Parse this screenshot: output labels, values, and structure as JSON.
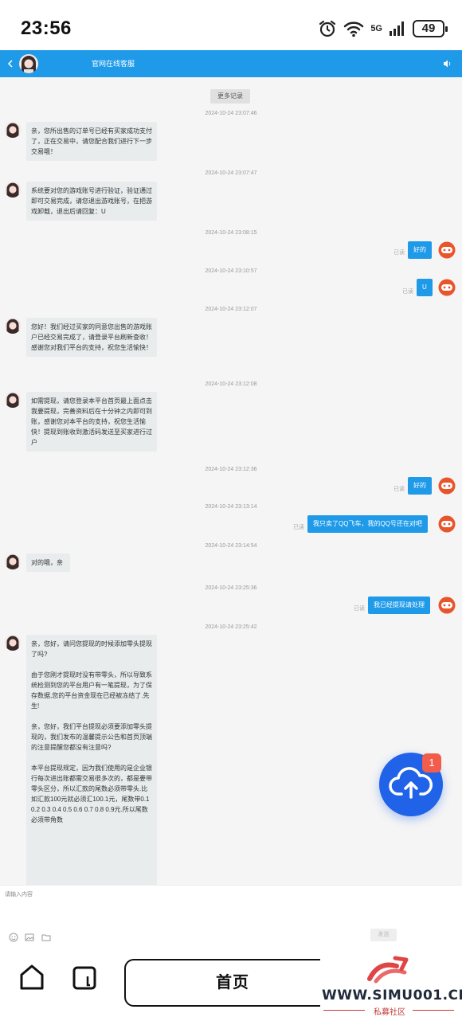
{
  "status_bar": {
    "time": "23:56",
    "network": "5G",
    "battery": "49",
    "icons": [
      "alarm-icon",
      "wifi-icon",
      "signal-icon",
      "battery-icon"
    ]
  },
  "header": {
    "title": "官网在线客服",
    "bg_color": "#1e9ae8",
    "icons": [
      "back-icon",
      "speaker-icon"
    ]
  },
  "chat": {
    "more_history": "更多记录",
    "read_label": "已读",
    "messages": [
      {
        "time": "2024-10-24 23:07:46",
        "side": "left",
        "paragraphs": [
          "亲，您所出售的订单号已经有买家成功支付了，正在交易中，请您配合我们进行下一步交易哦！"
        ]
      },
      {
        "time": "2024-10-24 23:07:47",
        "side": "left",
        "paragraphs": [
          "系统要对您的游戏账号进行验证，验证通过即可交易完成，请您退出游戏账号，在把游戏卸载，退出后请回复：U"
        ]
      },
      {
        "time": "2024-10-24 23:08:15",
        "side": "right",
        "text": "好的"
      },
      {
        "time": "2024-10-24 23:10:57",
        "side": "right",
        "text": "U"
      },
      {
        "time": "2024-10-24 23:12:07",
        "side": "left",
        "paragraphs": [
          "您好！我们经过买家的同意您出售的游戏账户已经交易完成了，请登录平台刷新查收！感谢您对我们平台的支持，祝您生活愉快！"
        ]
      },
      {
        "time": "2024-10-24 23:12:08",
        "side": "left",
        "paragraphs": [
          "如需提现，请您登录本平台首页最上面点击我要提现，完善资料后在十分钟之内即可到账，感谢您对本平台的支持，祝您生活愉快！提现到账收到激活码发送至买家进行过户"
        ]
      },
      {
        "time": "2024-10-24 23:12:36",
        "side": "right",
        "text": "好的"
      },
      {
        "time": "2024-10-24 23:13:14",
        "side": "right",
        "text": "我只卖了QQ飞车，我的QQ号还在对吧"
      },
      {
        "time": "2024-10-24 23:14:54",
        "side": "left",
        "paragraphs": [
          "对的哦，亲"
        ]
      },
      {
        "time": "2024-10-24 23:25:36",
        "side": "right",
        "text": "我已经提现请处理"
      },
      {
        "time": "2024-10-24 23:25:42",
        "side": "left",
        "paragraphs": [
          "亲，您好，请问您提现的时候添加零头提现了吗?",
          "由于您刚才提现时没有带零头，所以导致系统检测到您的平台用户有一笔提现，为了保存数据,您的平台资金现在已经被冻结了.先生!",
          "亲，您好，我们平台提现必须要添加零头提现的，我们发布的温馨提示公告和首页顶端的注意提醒您都没有注意吗?",
          "本平台提现规定，因为我们使用的是企业银行每次进出账都需交易很多次的，都是要带零头区分，所以汇款的尾数必须带零头.比如汇款100元就必须汇100.1元，尾数带0.1 0.2 0.3 0.4 0.5 0.6 0.7 0.8 0.9元.所以尾数必须带角数"
        ]
      }
    ]
  },
  "fab": {
    "badge": "1",
    "icon": "cloud-upload-icon",
    "color": "#2062e8"
  },
  "input": {
    "placeholder": "请输入内容",
    "send_label": "发送",
    "tools": [
      "emoji-icon",
      "image-icon",
      "folder-icon"
    ]
  },
  "nav": {
    "home_label": "首页",
    "icons": [
      "home-icon",
      "tabs-icon"
    ]
  },
  "watermark": {
    "url": "WWW.SIMU001.CN",
    "subtitle": "私募社区"
  }
}
